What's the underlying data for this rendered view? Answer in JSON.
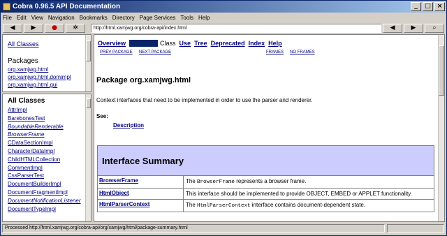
{
  "window": {
    "title": "Cobra 0.96.5 API Documentation"
  },
  "menu": [
    "File",
    "Edit",
    "View",
    "Navigation",
    "Bookmarks",
    "Directory",
    "Page Services",
    "Tools",
    "Help"
  ],
  "toolbar": {
    "url": "http://html.xamjwg.org/cobra-api/index.html"
  },
  "packages_frame": {
    "all_classes": "All Classes",
    "heading": "Packages",
    "packages": [
      "org.xamjwg.html",
      "org.xamjwg.html.domimpl",
      "org.xamjwg.html.gui"
    ]
  },
  "classes_frame": {
    "heading": "All Classes",
    "classes": [
      {
        "name": "AttrImpl",
        "italic": false
      },
      {
        "name": "BarebonesTest",
        "italic": false
      },
      {
        "name": "BoundableRenderable",
        "italic": true
      },
      {
        "name": "BrowserFrame",
        "italic": true
      },
      {
        "name": "CDataSectionImpl",
        "italic": false
      },
      {
        "name": "CharacterDataImpl",
        "italic": false
      },
      {
        "name": "ChildHTMLCollection",
        "italic": false
      },
      {
        "name": "CommentImpl",
        "italic": false
      },
      {
        "name": "CssParserTest",
        "italic": false
      },
      {
        "name": "DocumentBuilderImpl",
        "italic": false
      },
      {
        "name": "DocumentFragmentImpl",
        "italic": false
      },
      {
        "name": "DocumentNotificationListener",
        "italic": true
      },
      {
        "name": "DocumentTypeImpl",
        "italic": false
      }
    ]
  },
  "navbar": {
    "overview": "Overview",
    "class": "Class",
    "use": "Use",
    "tree": "Tree",
    "deprecated": "Deprecated",
    "index": "Index",
    "help": "Help",
    "prev_package": "PREV PACKAGE",
    "next_package": "NEXT PACKAGE",
    "frames": "FRAMES",
    "no_frames": "NO FRAMES"
  },
  "content": {
    "title": "Package org.xamjwg.html",
    "description": "Context interfaces that need to be implemented in order to use the parser and renderer.",
    "see_label": "See:",
    "see_link": "Description"
  },
  "interface_summary": {
    "heading": "Interface Summary",
    "rows": [
      {
        "name": "BrowserFrame",
        "pre": "The ",
        "code": "BrowserFrame",
        "post": " represents a browser frame."
      },
      {
        "name": "HtmlObject",
        "pre": "This interface should be implemented to provide OBJECT, EMBED or APPLET functionality.",
        "code": "",
        "post": ""
      },
      {
        "name": "HtmlParserContext",
        "pre": "The ",
        "code": "HtmlParserContext",
        "post": " interface contains document-dependent state."
      }
    ]
  },
  "status": {
    "text": "Processed http://html.xamjwg.org/cobra-api/org/xamjwg/html/package-summary.html"
  }
}
